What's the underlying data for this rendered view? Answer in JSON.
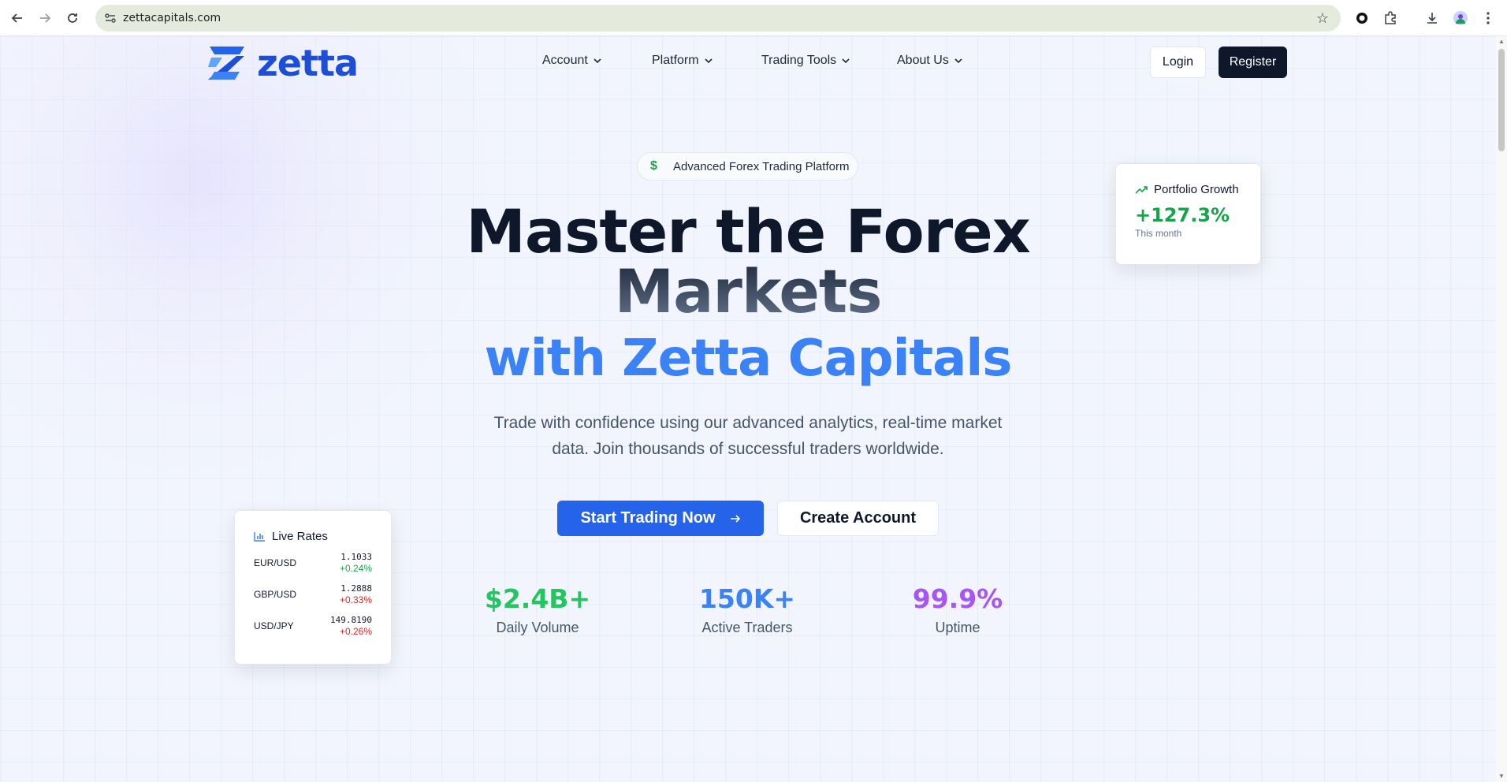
{
  "browser": {
    "url": "zettacapitals.com"
  },
  "header": {
    "logo_text": "zetta",
    "nav": [
      {
        "label": "Account"
      },
      {
        "label": "Platform"
      },
      {
        "label": "Trading Tools"
      },
      {
        "label": "About Us"
      }
    ],
    "login_label": "Login",
    "register_label": "Register"
  },
  "hero": {
    "badge": "Advanced Forex Trading Platform",
    "title_line1": "Master the Forex",
    "title_line2": "Markets",
    "title_line3": "with Zetta Capitals",
    "subtitle": "Trade with confidence using our advanced analytics, real-time market data. Join thousands of successful traders worldwide.",
    "cta_primary": "Start Trading Now",
    "cta_secondary": "Create Account"
  },
  "stats": [
    {
      "value": "$2.4B+",
      "label": "Daily Volume",
      "color": "#22c55e"
    },
    {
      "value": "150K+",
      "label": "Active Traders",
      "color": "#3b82f6"
    },
    {
      "value": "99.9%",
      "label": "Uptime",
      "color": "#a855f7"
    }
  ],
  "portfolio_card": {
    "title": "Portfolio Growth",
    "value": "+127.3%",
    "period": "This month"
  },
  "rates_card": {
    "title": "Live Rates",
    "rows": [
      {
        "pair": "EUR/USD",
        "price": "1.1033",
        "change": "+0.24%",
        "change_color": "#16a34a"
      },
      {
        "pair": "GBP/USD",
        "price": "1.2888",
        "change": "+0.33%",
        "change_color": "#dc2626"
      },
      {
        "pair": "USD/JPY",
        "price": "149.8190",
        "change": "+0.26%",
        "change_color": "#dc2626"
      }
    ]
  },
  "colors": {
    "brand": "#1d4ed8",
    "primary_button": "#2563eb",
    "dark_button": "#0f172a",
    "accent_blue": "#3b82f6"
  }
}
